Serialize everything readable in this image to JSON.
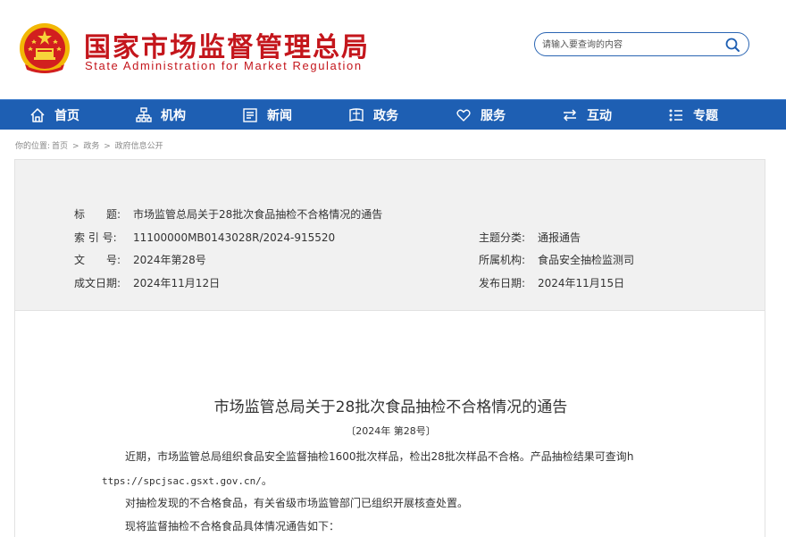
{
  "header": {
    "site_name": "国家市场监督管理总局",
    "site_name_en": "State Administration for Market Regulation",
    "search_placeholder": "请输入要查询的内容"
  },
  "nav": [
    {
      "label": "首页",
      "icon": "home-icon"
    },
    {
      "label": "机构",
      "icon": "org-icon"
    },
    {
      "label": "新闻",
      "icon": "news-icon"
    },
    {
      "label": "政务",
      "icon": "gov-icon"
    },
    {
      "label": "服务",
      "icon": "heart-icon"
    },
    {
      "label": "互动",
      "icon": "exchange-icon"
    },
    {
      "label": "专题",
      "icon": "list-icon"
    }
  ],
  "breadcrumb": {
    "prefix": "你的位置:",
    "items": [
      "首页",
      "政务",
      "政府信息公开"
    ],
    "separator": ">"
  },
  "meta": {
    "title_label": "标　　题:",
    "title_value": "市场监管总局关于28批次食品抽检不合格情况的通告",
    "index_label": "索 引 号:",
    "index_value": "11100000MB0143028R/2024-915520",
    "topic_label": "主题分类:",
    "topic_value": "通报通告",
    "docno_label": "文　　号:",
    "docno_value": "2024年第28号",
    "org_label": "所属机构:",
    "org_value": "食品安全抽检监测司",
    "created_label": "成文日期:",
    "created_value": "2024年11月12日",
    "published_label": "发布日期:",
    "published_value": "2024年11月15日"
  },
  "content": {
    "title": "市场监管总局关于28批次食品抽检不合格情况的通告",
    "doc_no": "〔2024年 第28号〕",
    "p1_text": "近期，市场监管总局组织食品安全监督抽检1600批次样品，检出28批次样品不合格。产品抽检结果可查询h",
    "p1_url": "ttps://spcjsac.gsxt.gov.cn/",
    "p1_end": "。",
    "p2": "对抽检发现的不合格食品，有关省级市场监管部门已组织开展核查处置。",
    "p3": "现将监督抽检不合格食品具体情况通告如下："
  },
  "colors": {
    "brand_red": "#c4161c",
    "nav_blue": "#1e5fb3"
  }
}
